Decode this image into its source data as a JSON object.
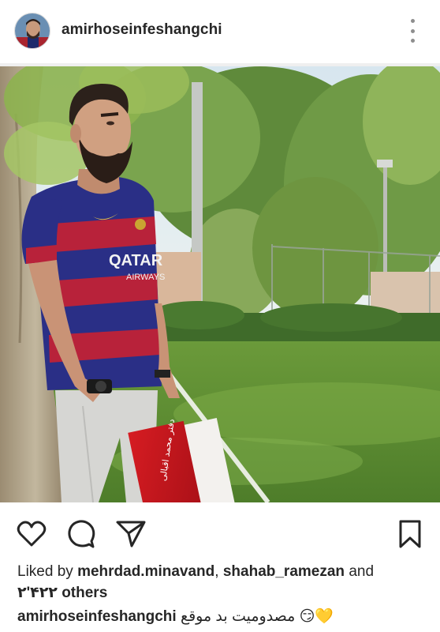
{
  "post": {
    "username": "amirhoseinfeshangchi",
    "likes_prefix": "Liked by",
    "liker1": "mehrdad.minavand",
    "liker_sep": ",",
    "liker2": "shahab_ramezan",
    "liker_and": "and",
    "others_count": "۲'۴۲۲",
    "others_label": "others",
    "caption_user": "amirhoseinfeshangchi",
    "caption_text": "💛😏 مصدومیت بد موقع"
  },
  "photo": {
    "shirt_text": "QATAR AIRWAYS",
    "folder_text": "دفتر محمد اقبالی"
  },
  "icons": {
    "heart": "heart-icon",
    "comment": "comment-icon",
    "share": "share-icon",
    "save": "bookmark-icon",
    "more": "more-options-icon"
  },
  "colors": {
    "text": "#262626",
    "muted": "#8e8e8e",
    "shirt_blue": "#2a2f86",
    "shirt_red": "#b8223a",
    "folder_red": "#c8141d"
  }
}
